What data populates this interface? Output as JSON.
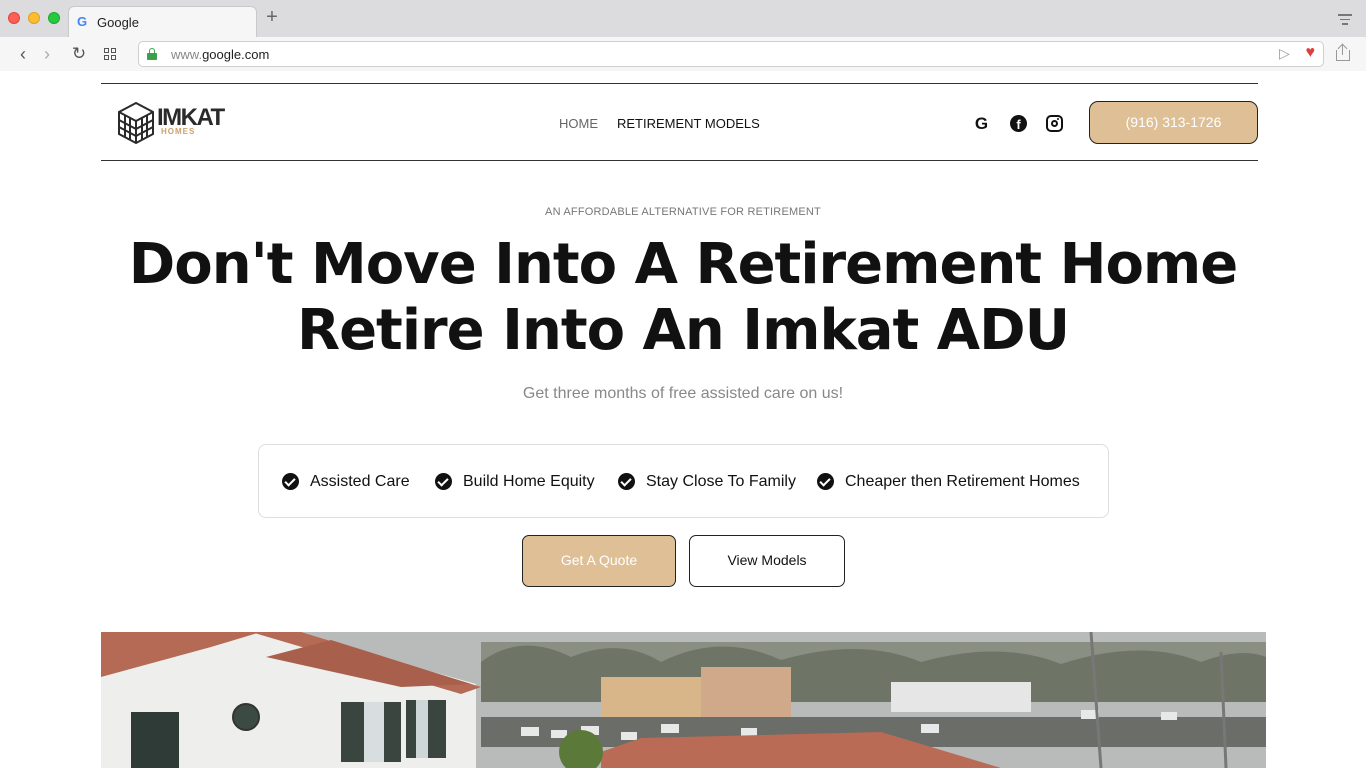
{
  "browser": {
    "tab_title": "Google",
    "url_prefix": "www.",
    "url_domain": "google.com"
  },
  "site": {
    "logo_text": "IMKAT",
    "logo_subtext": "HOMES",
    "nav": {
      "home": "HOME",
      "retirement_models": "RETIREMENT MODELS"
    },
    "phone": "(916) 313-1726",
    "social_icons": [
      "google-icon",
      "facebook-icon",
      "instagram-icon"
    ]
  },
  "hero": {
    "eyebrow": "AN AFFORDABLE ALTERNATIVE FOR RETIREMENT",
    "headline_line1": "Don't Move Into A Retirement Home",
    "headline_line2": "Retire Into An Imkat ADU",
    "subhead": "Get three months of free assisted care on us!",
    "features": [
      "Assisted Care",
      "Build Home Equity",
      "Stay Close To Family",
      "Cheaper then Retirement Homes"
    ],
    "cta_primary": "Get A Quote",
    "cta_secondary": "View Models"
  },
  "colors": {
    "accent": "#dfbf96",
    "text": "#111111",
    "muted": "#888888"
  }
}
